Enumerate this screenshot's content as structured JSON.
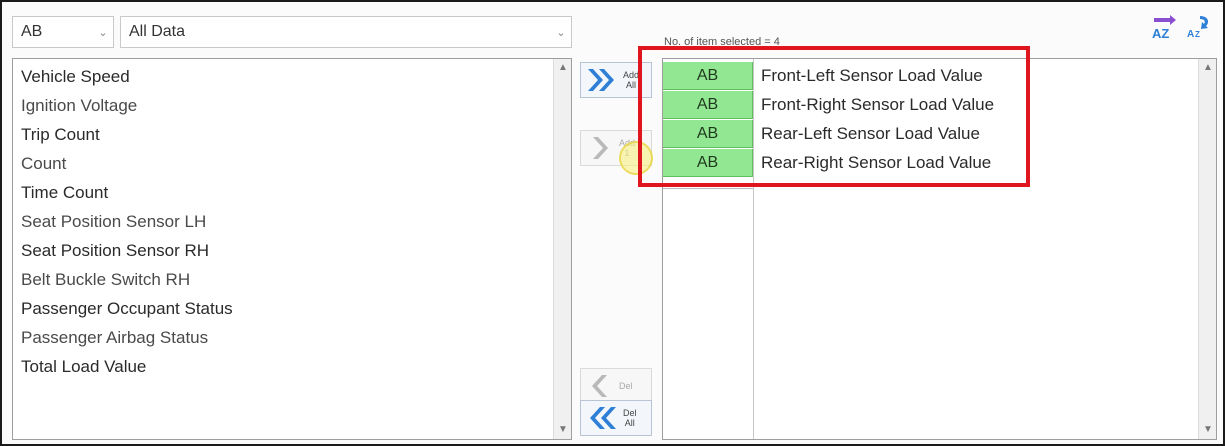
{
  "filters": {
    "type_value": "AB",
    "data_value": "All Data"
  },
  "available_items": [
    "Vehicle Speed",
    "Ignition Voltage",
    "Trip Count",
    "Count",
    "Time Count",
    "Seat Position Sensor LH",
    "Seat Position Sensor RH",
    "Belt Buckle Switch RH",
    "Passenger Occupant Status",
    "Passenger Airbag Status",
    "Total Load Value"
  ],
  "buttons": {
    "add_all_line1": "Add",
    "add_all_line2": "All",
    "add_one_line1": "Add",
    "add_one_line2": "1",
    "del_one": "Del",
    "del_all_line1": "Del",
    "del_all_line2": "All"
  },
  "selected": {
    "count_label": "No. of item selected = 4",
    "rows": [
      {
        "tag": "AB",
        "name": "Front-Left Sensor Load Value"
      },
      {
        "tag": "AB",
        "name": "Front-Right Sensor Load Value"
      },
      {
        "tag": "AB",
        "name": "Rear-Left Sensor Load Value"
      },
      {
        "tag": "AB",
        "name": "Rear-Right Sensor Load Value"
      }
    ]
  },
  "icons": {
    "sort_asc": "sort-az-icon",
    "sort_desc": "sort-za-icon"
  },
  "colors": {
    "selected_tag_bg": "#92e792",
    "highlight_box": "#e0161e",
    "arrow_blue": "#2e7fd6"
  }
}
